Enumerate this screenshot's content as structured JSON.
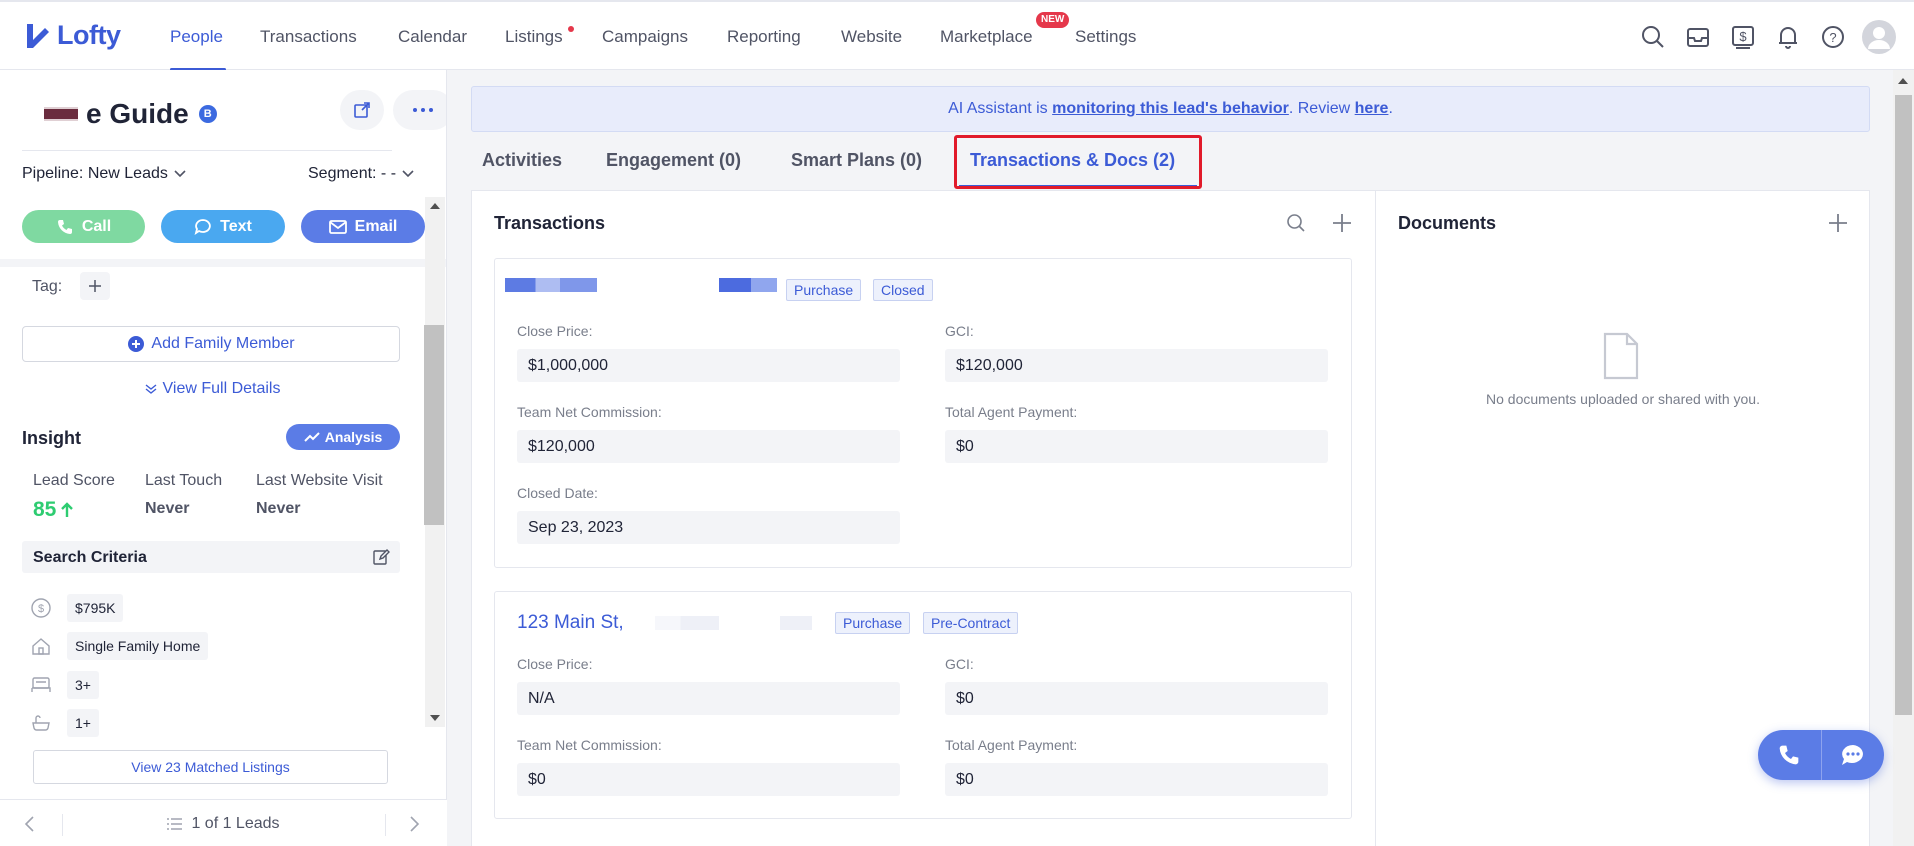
{
  "nav": {
    "brand": "Lofty",
    "items": [
      "People",
      "Transactions",
      "Calendar",
      "Listings",
      "Campaigns",
      "Reporting",
      "Website",
      "Marketplace",
      "Settings"
    ],
    "new_badge": "NEW"
  },
  "lead": {
    "name": "e Guide",
    "badge": "B",
    "pipeline": "Pipeline: New Leads",
    "segment": "Segment: - -",
    "call": "Call",
    "text": "Text",
    "email": "Email"
  },
  "details": {
    "tag_label": "Tag:",
    "add_family": "Add Family Member",
    "view_full": "View Full Details"
  },
  "insight": {
    "title": "Insight",
    "analysis": "Analysis",
    "lead_score_label": "Lead Score",
    "lead_score": "85",
    "last_touch_label": "Last Touch",
    "last_touch": "Never",
    "last_visit_label": "Last Website Visit",
    "last_visit": "Never"
  },
  "criteria": {
    "title": "Search Criteria",
    "price": "$795K",
    "home_type": "Single Family Home",
    "beds": "3+",
    "baths": "1+",
    "matched": "View 23 Matched Listings"
  },
  "pager": {
    "text": "1 of 1 Leads"
  },
  "banner": {
    "prefix": "AI Assistant is ",
    "link": "monitoring this lead's behavior",
    "middle": ". Review ",
    "here": "here",
    "suffix": "."
  },
  "tabs": [
    "Activities",
    "Engagement (0)",
    "Smart Plans (0)",
    "Transactions & Docs (2)"
  ],
  "transactions": {
    "title": "Transactions",
    "cards": [
      {
        "tags": [
          "Purchase",
          "Closed"
        ],
        "close_price_label": "Close Price:",
        "close_price": "$1,000,000",
        "gci_label": "GCI:",
        "gci": "$120,000",
        "team_net_label": "Team Net Commission:",
        "team_net": "$120,000",
        "agent_pay_label": "Total Agent Payment:",
        "agent_pay": "$0",
        "closed_date_label": "Closed Date:",
        "closed_date": "Sep 23, 2023"
      },
      {
        "address": "123 Main St,",
        "tags": [
          "Purchase",
          "Pre-Contract"
        ],
        "close_price_label": "Close Price:",
        "close_price": "N/A",
        "gci_label": "GCI:",
        "gci": "$0",
        "team_net_label": "Team Net Commission:",
        "team_net": "$0",
        "agent_pay_label": "Total Agent Payment:",
        "agent_pay": "$0"
      }
    ]
  },
  "documents": {
    "title": "Documents",
    "empty": "No documents uploaded or shared with you."
  },
  "colors": {
    "primary": "#3c5bd6",
    "call": "#7fd9a1",
    "text": "#4aa8f0",
    "email": "#5b7ce6",
    "highlight": "#e11a2a",
    "score": "#2ecc71"
  }
}
